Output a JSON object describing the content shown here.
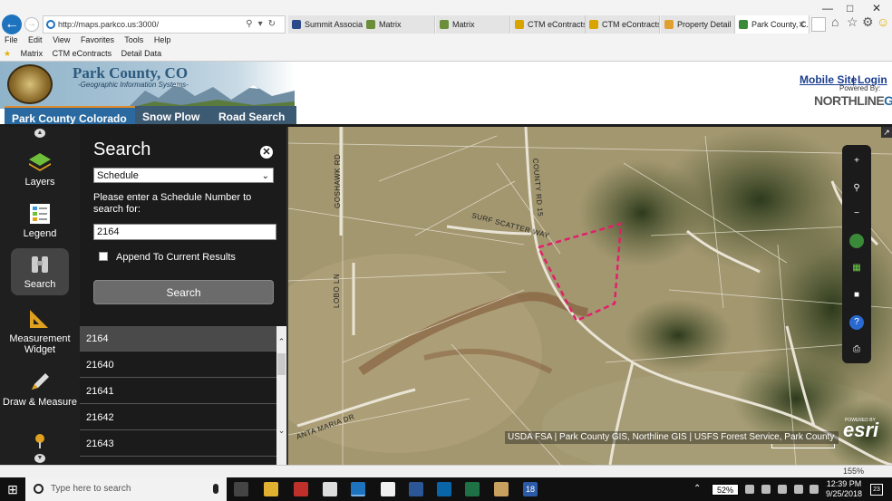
{
  "browser": {
    "address_url": "http://maps.parkco.us:3000/",
    "tabs": [
      {
        "label": "Summit Associati...",
        "icon": "summit-icon",
        "color": "#2a4a8a"
      },
      {
        "label": "Matrix",
        "icon": "matrix-icon",
        "color": "#6b8e3a"
      },
      {
        "label": "Matrix",
        "icon": "matrix-icon",
        "color": "#6b8e3a"
      },
      {
        "label": "CTM eContracts",
        "icon": "ctm-icon",
        "color": "#d9a400"
      },
      {
        "label": "CTM eContracts",
        "icon": "ctm-icon",
        "color": "#d9a400"
      },
      {
        "label": "Property Detail",
        "icon": "page-icon",
        "color": "#e0a030"
      },
      {
        "label": "Park County, C...",
        "icon": "parkcounty-icon",
        "color": "#3a8a3a"
      }
    ],
    "menu": [
      "File",
      "Edit",
      "View",
      "Favorites",
      "Tools",
      "Help"
    ],
    "favorites": [
      "Matrix",
      "CTM eContracts",
      "Detail Data"
    ]
  },
  "site": {
    "title": "Park County, CO",
    "subtitle": "-Geographic Information Systems-",
    "nav_tabs": [
      "Park County Colorado",
      "Snow Plow",
      "Road Search"
    ],
    "mobile_site": "Mobile Site",
    "separator": "|",
    "login": "Login",
    "powered_by": "Powered By:",
    "northline_a": "NORTHLINE",
    "northline_b": "GIS"
  },
  "toolbar": {
    "items": [
      {
        "label": "Layers",
        "icon": "layers-icon"
      },
      {
        "label": "Legend",
        "icon": "legend-icon"
      },
      {
        "label": "Search",
        "icon": "binoculars-icon",
        "active": true
      },
      {
        "label": "Measurement Widget",
        "icon": "ruler-icon"
      },
      {
        "label": "Draw & Measure",
        "icon": "pencil-icon"
      }
    ]
  },
  "search": {
    "title": "Search",
    "type_selected": "Schedule",
    "prompt": "Please enter a Schedule Number to search for:",
    "input_value": "2164",
    "append_label": "Append To Current Results",
    "append_checked": false,
    "button_label": "Search",
    "results": [
      "2164",
      "21640",
      "21641",
      "21642",
      "21643"
    ],
    "selected_result": "2164"
  },
  "map": {
    "road_labels": [
      "GOSHAWK RD",
      "COUNTY RD 15",
      "SURF SCATTER WAY",
      "LOBO LN",
      "ANTA MARIA DR"
    ],
    "attribution": "USDA FSA | Park County GIS, Northline GIS | USFS Forest Service, Park County",
    "powered_by_esri": "POWERED BY",
    "esri": "esri",
    "parcel_color": "#e0206a",
    "tools": [
      "zoom-in-icon",
      "zoom-extent-icon",
      "zoom-out-icon",
      "globe-icon",
      "fullscreen-icon",
      "comment-icon",
      "help-icon",
      "print-icon"
    ]
  },
  "statusbar": {
    "zoom": "155%"
  },
  "taskbar": {
    "search_placeholder": "Type here to search",
    "battery": "52%",
    "time": "12:39 PM",
    "date": "9/25/2018",
    "notifications": "23",
    "pinned_count_badge": "18"
  }
}
